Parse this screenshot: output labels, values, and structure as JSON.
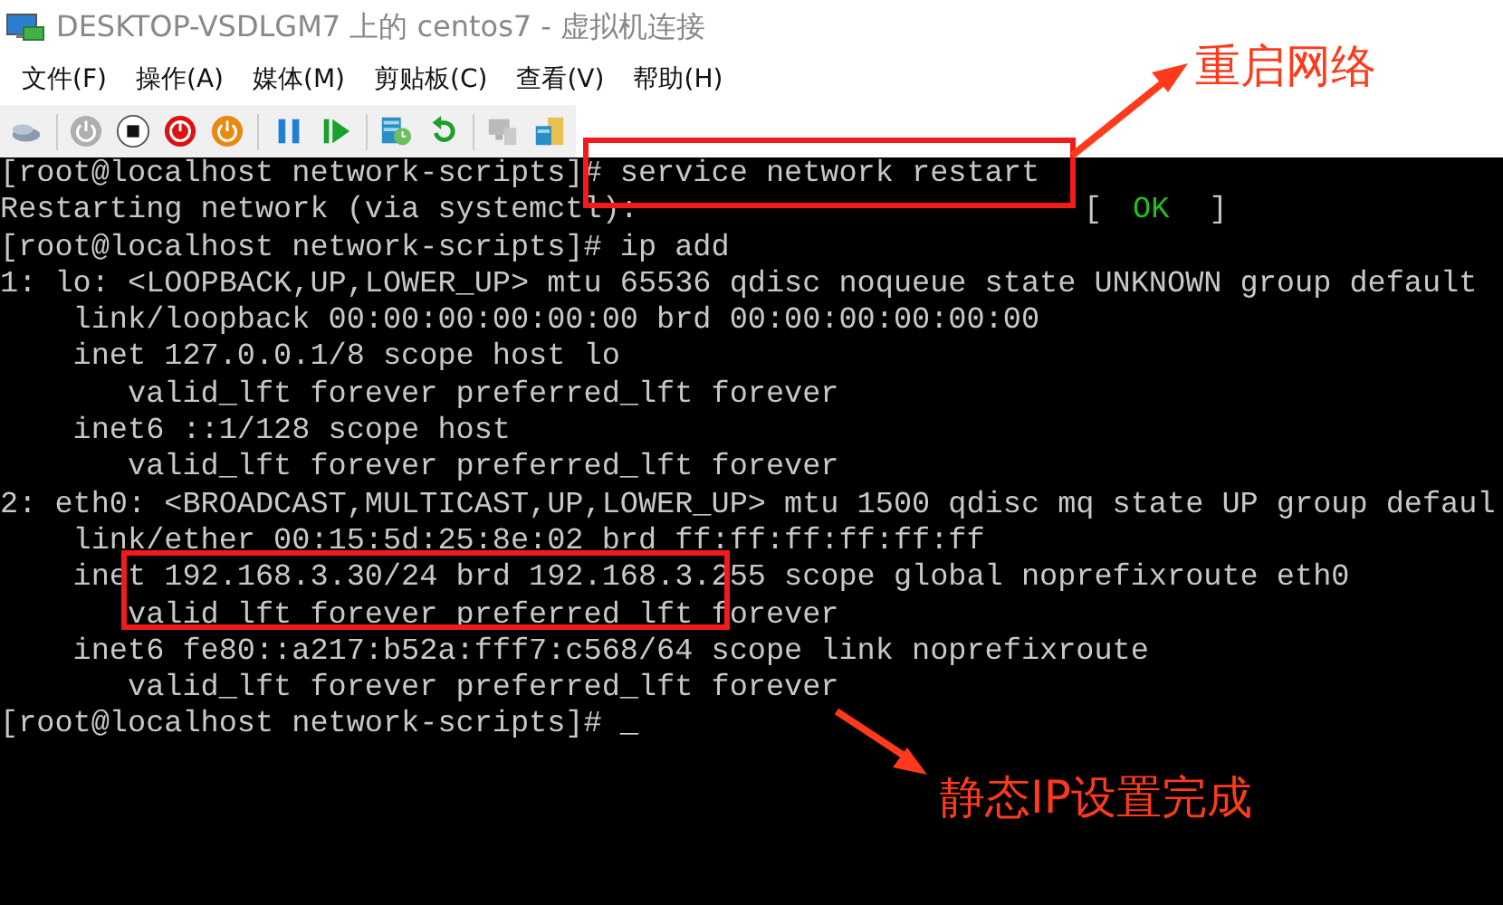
{
  "window": {
    "title": "DESKTOP-VSDLGM7 上的 centos7 - 虚拟机连接"
  },
  "menu": [
    "文件(F)",
    "操作(A)",
    "媒体(M)",
    "剪贴板(C)",
    "查看(V)",
    "帮助(H)"
  ],
  "toolbar": [
    {
      "kind": "ctrl-alt-del",
      "disabled": false
    },
    {
      "kind": "separator"
    },
    {
      "kind": "start",
      "disabled": true
    },
    {
      "kind": "turn-off",
      "disabled": false
    },
    {
      "kind": "shut-down",
      "disabled": false
    },
    {
      "kind": "save",
      "disabled": false
    },
    {
      "kind": "separator"
    },
    {
      "kind": "pause",
      "disabled": false
    },
    {
      "kind": "reset",
      "disabled": false
    },
    {
      "kind": "separator"
    },
    {
      "kind": "checkpoint",
      "disabled": false
    },
    {
      "kind": "revert",
      "disabled": false
    },
    {
      "kind": "separator"
    },
    {
      "kind": "enhanced-session",
      "disabled": true
    },
    {
      "kind": "share",
      "disabled": false
    }
  ],
  "terminal": {
    "lines": [
      {
        "text": "[root@localhost network-scripts]# service network restart"
      },
      {
        "text": "Restarting network (via systemctl):",
        "status": {
          "open": "[",
          "label": "OK",
          "close": "]"
        }
      },
      {
        "text": "[root@localhost network-scripts]# ip add"
      },
      {
        "text": "1: lo: <LOOPBACK,UP,LOWER_UP> mtu 65536 qdisc noqueue state UNKNOWN group default"
      },
      {
        "text": "    link/loopback 00:00:00:00:00:00 brd 00:00:00:00:00:00"
      },
      {
        "text": "    inet 127.0.0.1/8 scope host lo"
      },
      {
        "text": "       valid_lft forever preferred_lft forever"
      },
      {
        "text": "    inet6 ::1/128 scope host"
      },
      {
        "text": "       valid_lft forever preferred_lft forever"
      },
      {
        "text": "2: eth0: <BROADCAST,MULTICAST,UP,LOWER_UP> mtu 1500 qdisc mq state UP group defaul"
      },
      {
        "text": "    link/ether 00:15:5d:25:8e:02 brd ff:ff:ff:ff:ff:ff"
      },
      {
        "text": "    inet 192.168.3.30/24 brd 192.168.3.255 scope global noprefixroute eth0"
      },
      {
        "text": "       valid_lft forever preferred_lft forever"
      },
      {
        "text": "    inet6 fe80::a217:b52a:fff7:c568/64 scope link noprefixroute"
      },
      {
        "text": "       valid_lft forever preferred_lft forever"
      },
      {
        "text": "[root@localhost network-scripts]# ",
        "cursor": "_"
      }
    ]
  },
  "annotations": [
    {
      "label": "重启网络"
    },
    {
      "label": "静态IP设置完成"
    }
  ]
}
